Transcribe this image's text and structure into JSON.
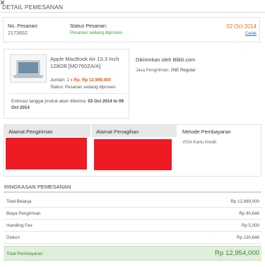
{
  "header": {
    "title": "DETAIL PEMESANAN"
  },
  "order": {
    "number_label": "No. Pesanan:",
    "number_value": "2173652",
    "status_label": "Status Pesanan:",
    "status_value": "Pesanan sedang diproses",
    "date": "02 Oct 2014",
    "print_link": "Cetak"
  },
  "product": {
    "name": "Apple MacBook Air 13.3 Inch 128GB [MD760ZA/A]",
    "qty_label": "Jumlah:",
    "qty_value": "1 x",
    "price": "Rp. Rp 12,999,000",
    "status_label": "Status:",
    "status_value": "Pesanan sedang diproses",
    "estimate_label": "Estimasi tanggal produk akan diterima:",
    "estimate_value": "03 Oct 2014 to 09 Oct 2014"
  },
  "shipping": {
    "title": "Dikirimkan oleh Blibli.com",
    "service_label": "Jasa Pengiriman:",
    "service_value": "JNE Regular"
  },
  "addresses": {
    "shipping_head": "Alamat Pengiriman",
    "billing_head": "Alamat Penagihan",
    "payment_head": "Metode Pembayaran",
    "payment_value": "VISA Kartu Kredit",
    "redacted_color": "#ee1b24"
  },
  "summary": {
    "title": "RINGKASAN PEMESANAN",
    "rows": [
      {
        "label": "Total Belanja",
        "value": "Rp 12,999,000"
      },
      {
        "label": "Biaya Pengiriman",
        "value": "Rp 80,648"
      },
      {
        "label": "Handling Fee",
        "value": "Rp 5,000"
      },
      {
        "label": "Diskon",
        "value": "Rp 130,648"
      }
    ],
    "total_label": "Total Pembayaran",
    "total_value": "Rp 12,954,000"
  },
  "colors": {
    "accent_orange": "#e2750a",
    "link_blue": "#2f6fb5",
    "total_green": "#3a8a35"
  }
}
